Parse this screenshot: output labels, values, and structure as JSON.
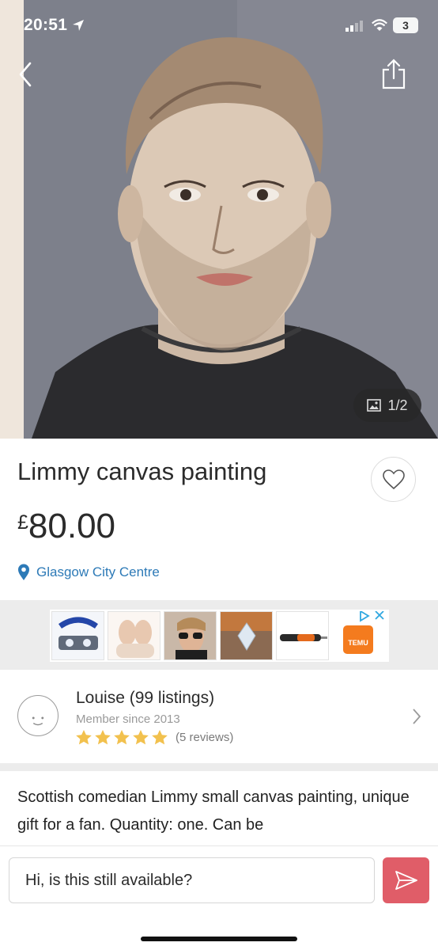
{
  "status_bar": {
    "time": "20:51",
    "battery": "3"
  },
  "hero": {
    "photo_counter": "1/2"
  },
  "listing": {
    "title": "Limmy canvas painting",
    "price_currency": "£",
    "price_amount": "80.00",
    "location": "Glasgow City Centre"
  },
  "ad": {
    "brand": "TEMU"
  },
  "seller": {
    "name_line": "Louise (99 listings)",
    "member_since": "Member since 2013",
    "stars": 5,
    "reviews": "(5 reviews)"
  },
  "description": {
    "text": "Scottish comedian Limmy small canvas painting, unique gift for a fan. Quantity: one. Can be"
  },
  "message": {
    "value": "Hi, is this still available?"
  },
  "colors": {
    "accent_link": "#2d7ab7",
    "send_button": "#e05d68",
    "star": "#f2c14e"
  },
  "icons": [
    "location-arrow-icon",
    "signal-icon",
    "wifi-icon",
    "back-chevron-icon",
    "share-icon",
    "image-icon",
    "heart-icon",
    "location-pin-icon",
    "ad-choices-icon",
    "close-icon",
    "star-icon",
    "chevron-right-icon",
    "send-icon"
  ]
}
